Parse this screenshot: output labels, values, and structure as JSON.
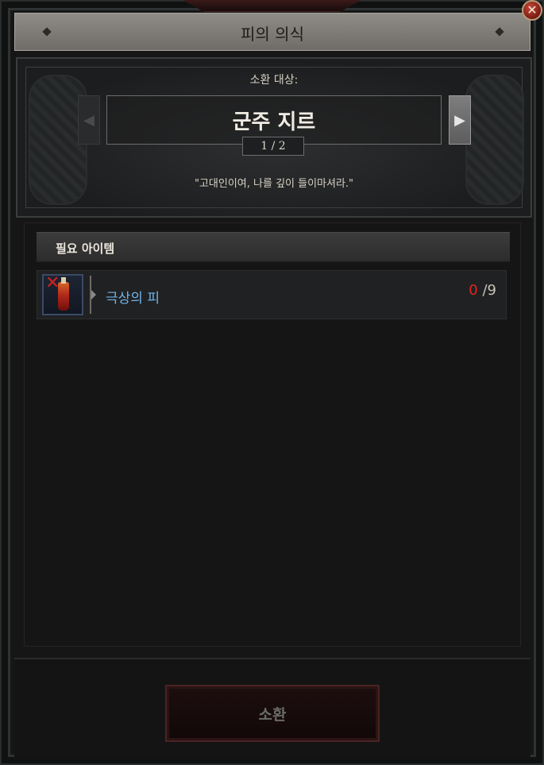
{
  "window": {
    "title": "피의 의식",
    "close_icon": "close-icon"
  },
  "summon": {
    "label": "소환 대상:",
    "target_name": "군주 지르",
    "page": "1 / 2",
    "quote": "\"고대인이여, 나를 깊이 들이마셔라.\"",
    "prev_icon": "arrow-left-icon",
    "next_icon": "arrow-right-icon"
  },
  "required": {
    "title": "필요 아이템",
    "items": [
      {
        "name": "극상의 피",
        "have": "0",
        "need": "/9",
        "icon": "blood-vial-icon",
        "status_icon": "cross-icon"
      }
    ]
  },
  "actions": {
    "summon_label": "소환"
  },
  "colors": {
    "item_name": "#6fb4ea",
    "count_have": "#e0281e",
    "title_bar": "#8f8c86",
    "summon_button_border": "#4a2323"
  }
}
